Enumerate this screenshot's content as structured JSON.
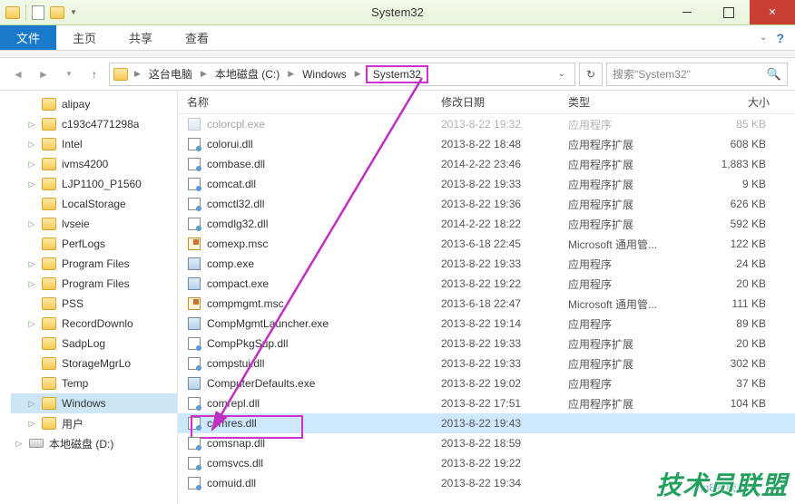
{
  "window": {
    "title": "System32"
  },
  "ribbon": {
    "file": "文件",
    "tabs": [
      "主页",
      "共享",
      "查看"
    ]
  },
  "breadcrumb": {
    "parts": [
      "这台电脑",
      "本地磁盘 (C:)",
      "Windows"
    ],
    "current": "System32"
  },
  "search": {
    "placeholder": "搜索\"System32\""
  },
  "sidebar": {
    "items": [
      {
        "label": "alipay",
        "arrow": "none",
        "icon": "folder",
        "level": 1
      },
      {
        "label": "c193c4771298a",
        "arrow": "▷",
        "icon": "folder",
        "level": 1
      },
      {
        "label": "Intel",
        "arrow": "▷",
        "icon": "folder",
        "level": 1
      },
      {
        "label": "ivms4200",
        "arrow": "▷",
        "icon": "folder",
        "level": 1
      },
      {
        "label": "LJP1100_P1560",
        "arrow": "▷",
        "icon": "folder",
        "level": 1
      },
      {
        "label": "LocalStorage",
        "arrow": "none",
        "icon": "folder",
        "level": 1
      },
      {
        "label": "lvseie",
        "arrow": "▷",
        "icon": "folder",
        "level": 1
      },
      {
        "label": "PerfLogs",
        "arrow": "none",
        "icon": "folder",
        "level": 1
      },
      {
        "label": "Program Files",
        "arrow": "▷",
        "icon": "folder",
        "level": 1
      },
      {
        "label": "Program Files",
        "arrow": "▷",
        "icon": "folder",
        "level": 1
      },
      {
        "label": "PSS",
        "arrow": "none",
        "icon": "folder",
        "level": 1
      },
      {
        "label": "RecordDownlo",
        "arrow": "▷",
        "icon": "folder",
        "level": 1
      },
      {
        "label": "SadpLog",
        "arrow": "none",
        "icon": "folder",
        "level": 1
      },
      {
        "label": "StorageMgrLo",
        "arrow": "none",
        "icon": "folder",
        "level": 1
      },
      {
        "label": "Temp",
        "arrow": "none",
        "icon": "folder",
        "level": 1
      },
      {
        "label": "Windows",
        "arrow": "▷",
        "icon": "folder",
        "level": 1,
        "selected": true
      },
      {
        "label": "用户",
        "arrow": "▷",
        "icon": "folder",
        "level": 1
      },
      {
        "label": "本地磁盘 (D:)",
        "arrow": "▷",
        "icon": "disk",
        "level": 0
      }
    ]
  },
  "columns": {
    "name": "名称",
    "date": "修改日期",
    "type": "类型",
    "size": "大小"
  },
  "files": [
    {
      "name": "colorcpl.exe",
      "date": "2013-8-22 19:32",
      "type": "应用程序",
      "size": "85 KB",
      "icon": "exe"
    },
    {
      "name": "colorui.dll",
      "date": "2013-8-22 18:48",
      "type": "应用程序扩展",
      "size": "608 KB",
      "icon": "dll"
    },
    {
      "name": "combase.dll",
      "date": "2014-2-22 23:46",
      "type": "应用程序扩展",
      "size": "1,883 KB",
      "icon": "dll"
    },
    {
      "name": "comcat.dll",
      "date": "2013-8-22 19:33",
      "type": "应用程序扩展",
      "size": "9 KB",
      "icon": "dll"
    },
    {
      "name": "comctl32.dll",
      "date": "2013-8-22 19:36",
      "type": "应用程序扩展",
      "size": "626 KB",
      "icon": "dll"
    },
    {
      "name": "comdlg32.dll",
      "date": "2014-2-22 18:22",
      "type": "应用程序扩展",
      "size": "592 KB",
      "icon": "dll"
    },
    {
      "name": "comexp.msc",
      "date": "2013-6-18 22:45",
      "type": "Microsoft 通用管...",
      "size": "122 KB",
      "icon": "msc"
    },
    {
      "name": "comp.exe",
      "date": "2013-8-22 19:33",
      "type": "应用程序",
      "size": "24 KB",
      "icon": "exe"
    },
    {
      "name": "compact.exe",
      "date": "2013-8-22 19:22",
      "type": "应用程序",
      "size": "20 KB",
      "icon": "exe"
    },
    {
      "name": "compmgmt.msc",
      "date": "2013-6-18 22:47",
      "type": "Microsoft 通用管...",
      "size": "111 KB",
      "icon": "msc"
    },
    {
      "name": "CompMgmtLauncher.exe",
      "date": "2013-8-22 19:14",
      "type": "应用程序",
      "size": "89 KB",
      "icon": "exe"
    },
    {
      "name": "CompPkgSup.dll",
      "date": "2013-8-22 19:33",
      "type": "应用程序扩展",
      "size": "20 KB",
      "icon": "dll"
    },
    {
      "name": "compstui.dll",
      "date": "2013-8-22 19:33",
      "type": "应用程序扩展",
      "size": "302 KB",
      "icon": "dll"
    },
    {
      "name": "ComputerDefaults.exe",
      "date": "2013-8-22 19:02",
      "type": "应用程序",
      "size": "37 KB",
      "icon": "exe"
    },
    {
      "name": "comrepl.dll",
      "date": "2013-8-22 17:51",
      "type": "应用程序扩展",
      "size": "104 KB",
      "icon": "dll"
    },
    {
      "name": "comres.dll",
      "date": "2013-8-22 19:43",
      "type": "",
      "size": "",
      "icon": "dll",
      "selected": true,
      "highlight": true
    },
    {
      "name": "comsnap.dll",
      "date": "2013-8-22 18:59",
      "type": "",
      "size": "",
      "icon": "dll"
    },
    {
      "name": "comsvcs.dll",
      "date": "2013-8-22 19:22",
      "type": "",
      "size": "",
      "icon": "dll"
    },
    {
      "name": "comuid.dll",
      "date": "2013-8-22 19:34",
      "type": "",
      "size": "",
      "icon": "dll"
    }
  ],
  "watermark": {
    "main": "技术员联盟",
    "sub": "Win8系统之家"
  }
}
